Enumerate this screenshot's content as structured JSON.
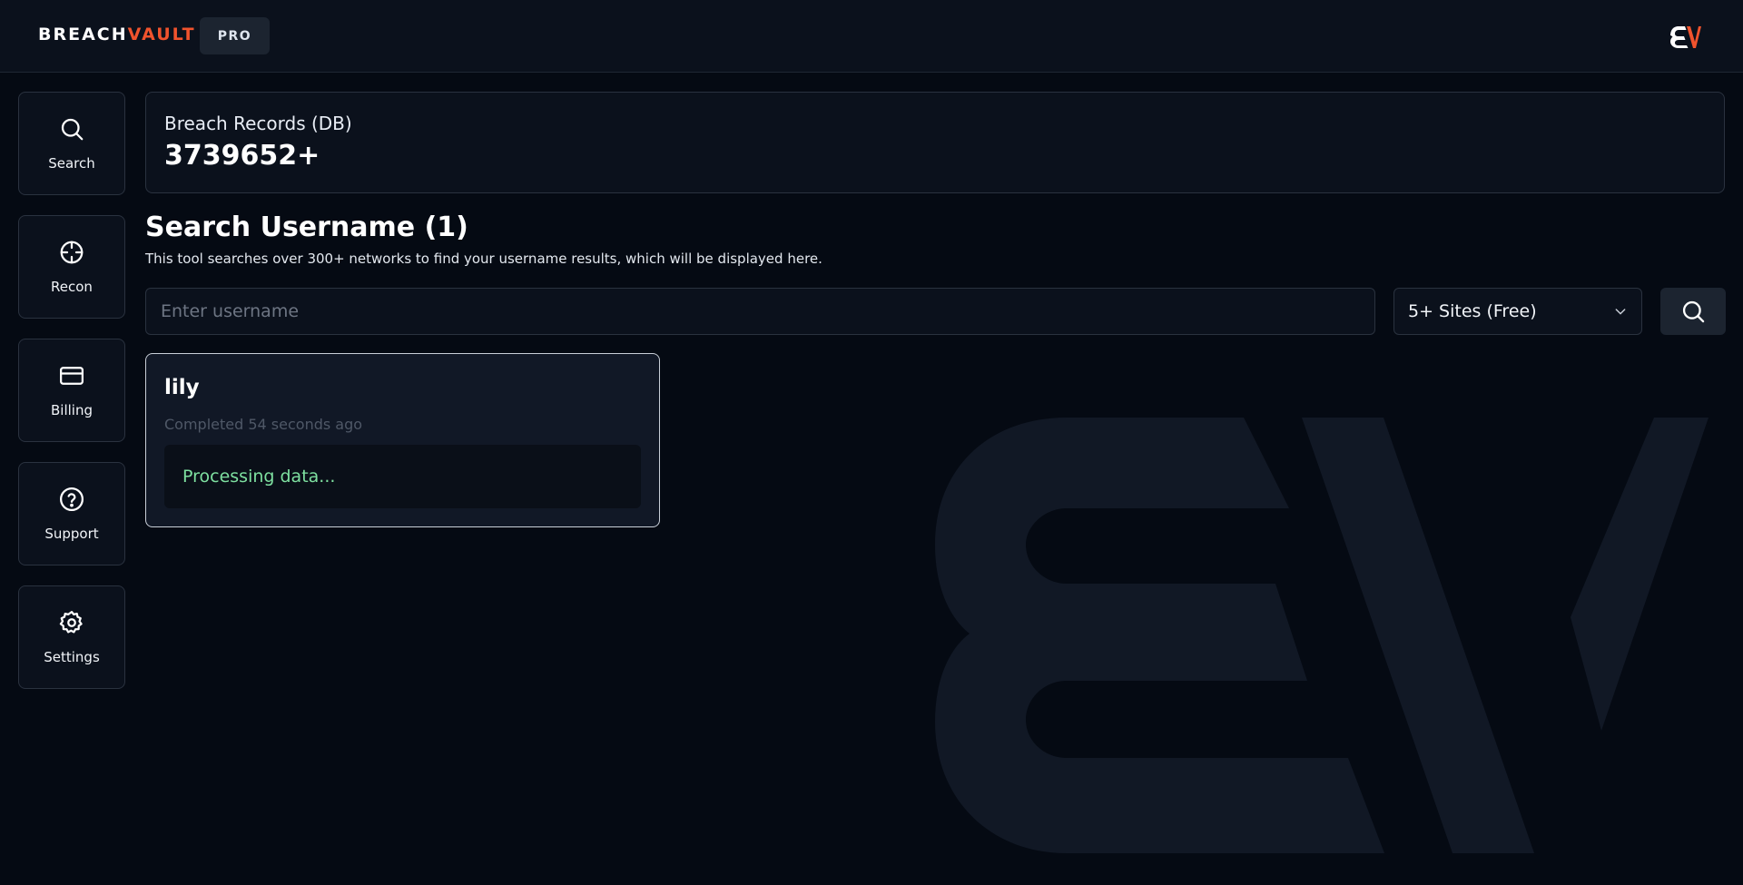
{
  "brand": {
    "logo_text_main": "BREACH",
    "logo_text_accent": "VAULT",
    "plan_badge": "PRO",
    "accent_color": "#f1532d"
  },
  "sidebar": {
    "items": [
      {
        "label": "Search",
        "icon": "search-icon"
      },
      {
        "label": "Recon",
        "icon": "crosshair-icon"
      },
      {
        "label": "Billing",
        "icon": "credit-card-icon"
      },
      {
        "label": "Support",
        "icon": "help-circle-icon"
      },
      {
        "label": "Settings",
        "icon": "gear-icon"
      }
    ]
  },
  "stats": {
    "label": "Breach Records (DB)",
    "value": "3739652+"
  },
  "main": {
    "title": "Search Username (1)",
    "description": "This tool searches over 300+ networks to find your username results, which will be displayed here.",
    "search": {
      "placeholder": "Enter username",
      "value": ""
    },
    "site_select": {
      "selected": "5+ Sites (Free)"
    }
  },
  "results": [
    {
      "username": "lily",
      "time": "Completed 54 seconds ago",
      "status": "Processing data..."
    }
  ]
}
